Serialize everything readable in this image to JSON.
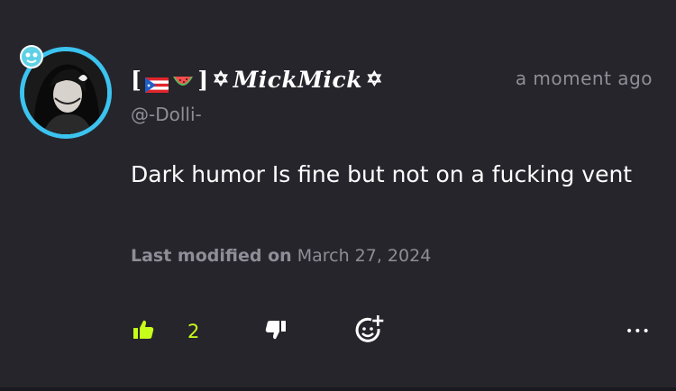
{
  "comment": {
    "author_name": "MickMick",
    "name_prefix": "[",
    "name_mid": "]",
    "star_glyph": "✡",
    "handle": "@-Dolli-",
    "timestamp": "a moment ago",
    "text": "Dark humor Is fine but not on a fucking vent",
    "modified_label": "Last modified on",
    "modified_date": "March 27, 2024"
  },
  "actions": {
    "like_count": "2",
    "more_glyph": "•••"
  },
  "colors": {
    "background": "#26252c",
    "accent_like": "#c8ff1a",
    "muted_text": "#8f8e97",
    "avatar_ring": "#3cc3ef"
  },
  "icons": [
    "thumbs-up-icon",
    "thumbs-down-icon",
    "add-reaction-icon",
    "more-icon",
    "puerto-rico-flag-icon",
    "watermelon-icon"
  ]
}
